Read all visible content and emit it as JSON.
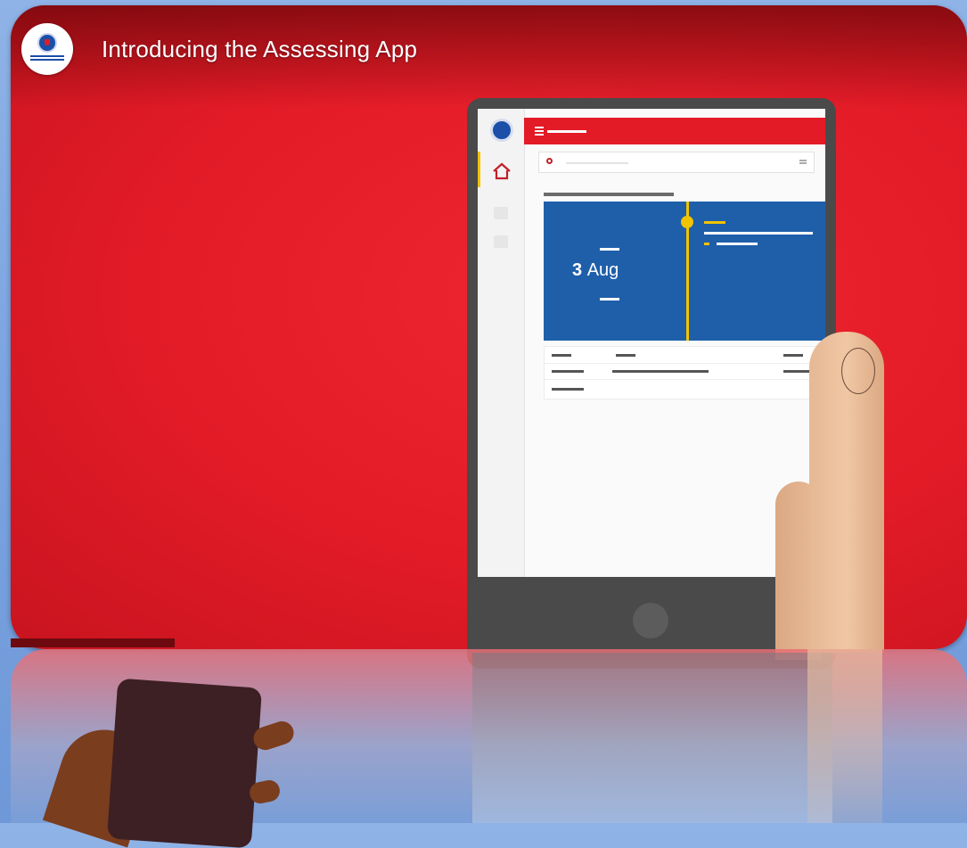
{
  "video": {
    "title": "Introducing the Assessing App",
    "channel_logo": "nsw-health-logo"
  },
  "app": {
    "date_day": "3",
    "date_month": "Aug",
    "home_icon": "home-icon",
    "search_icon": "search-icon",
    "menu_icon": "menu-icon"
  },
  "colors": {
    "brand_red": "#e21b27",
    "card_blue": "#1f5faa",
    "accent_yellow": "#f2c300"
  }
}
